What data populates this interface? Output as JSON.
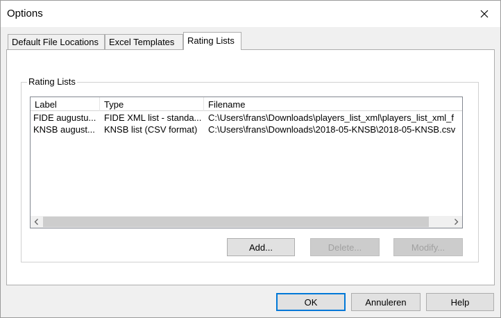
{
  "window": {
    "title": "Options"
  },
  "tabs": [
    {
      "label": "Default File Locations",
      "active": false
    },
    {
      "label": "Excel Templates",
      "active": false
    },
    {
      "label": "Rating Lists",
      "active": true
    }
  ],
  "rating_lists": {
    "group_title": "Rating Lists",
    "columns": [
      "Label",
      "Type",
      "Filename"
    ],
    "rows": [
      {
        "label": "FIDE augustu...",
        "type": "FIDE XML list - standa...",
        "filename": "C:\\Users\\frans\\Downloads\\players_list_xml\\players_list_xml_f"
      },
      {
        "label": "KNSB august...",
        "type": "KNSB list (CSV format)",
        "filename": "C:\\Users\\frans\\Downloads\\2018-05-KNSB\\2018-05-KNSB.csv"
      }
    ],
    "buttons": {
      "add": "Add...",
      "delete": "Delete...",
      "modify": "Modify..."
    }
  },
  "dialog_buttons": {
    "ok": "OK",
    "cancel": "Annuleren",
    "help": "Help"
  },
  "icons": {
    "close": "close-icon",
    "scroll_left": "chevron-left-icon",
    "scroll_right": "chevron-right-icon"
  },
  "colors": {
    "accent": "#0078d7"
  }
}
